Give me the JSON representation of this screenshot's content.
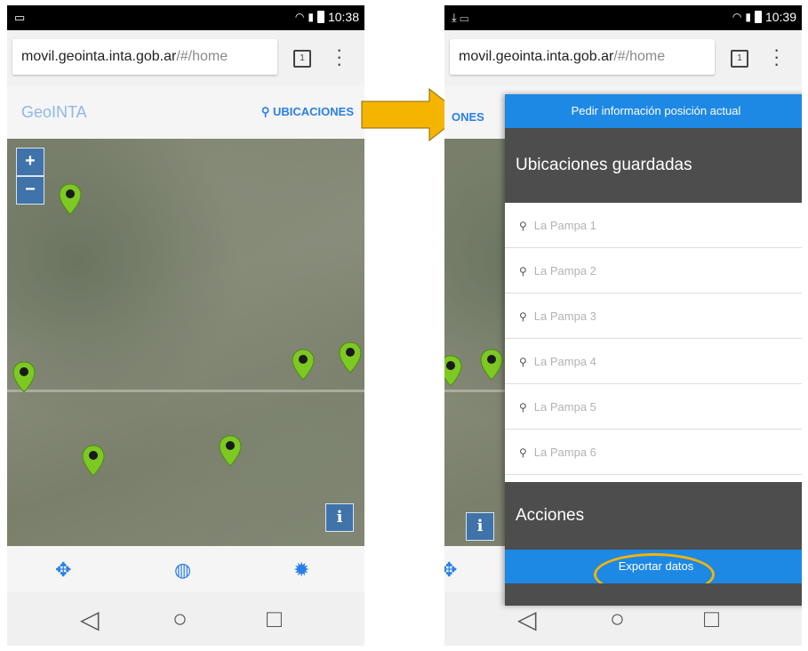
{
  "left": {
    "status": {
      "time": "10:38"
    },
    "url": {
      "host": "movil.geointa.inta.gob.ar",
      "path": "/#/home"
    },
    "tabs_count": "1",
    "header": {
      "brand": "GeoINTA",
      "locations_label": "UBICACIONES"
    },
    "map": {
      "zoom_in": "+",
      "zoom_out": "−",
      "info": "i"
    }
  },
  "right": {
    "status": {
      "time": "10:39"
    },
    "url": {
      "host": "movil.geointa.inta.gob.ar",
      "path": "/#/home"
    },
    "tabs_count": "1",
    "header_fragment": "ONES",
    "drawer": {
      "request_position": "Pedir información posición actual",
      "saved_title": "Ubicaciones guardadas",
      "items": [
        "La Pampa 1",
        "La Pampa 2",
        "La Pampa 3",
        "La Pampa 4",
        "La Pampa 5",
        "La Pampa 6"
      ],
      "actions_title": "Acciones",
      "export_label": "Exportar datos"
    },
    "map": {
      "info": "i"
    }
  },
  "colors": {
    "accent_blue": "#1e88e5",
    "marker_green": "#7dc823",
    "drawer_dark": "#4d4d4d",
    "highlight_orange": "#f4b400"
  }
}
